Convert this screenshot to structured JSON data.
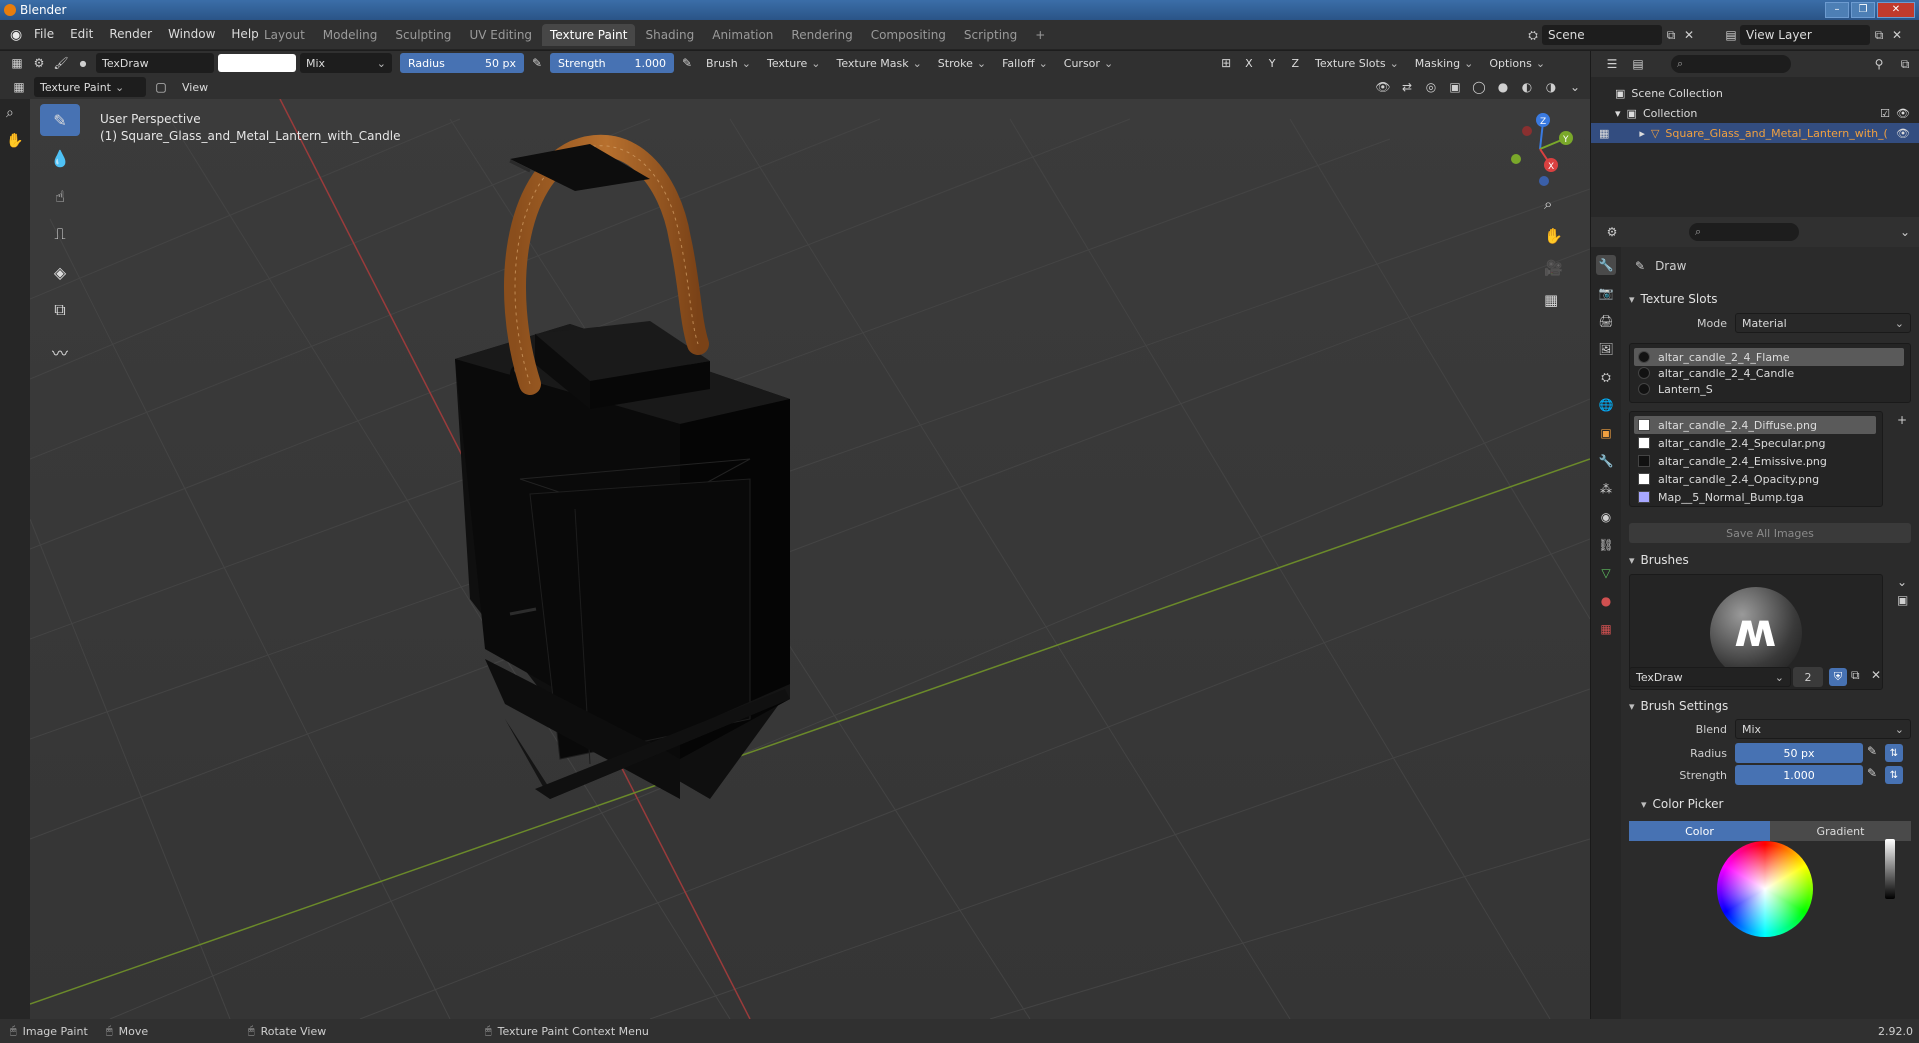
{
  "window": {
    "title": "Blender",
    "controls": [
      "–",
      "❐",
      "✕"
    ]
  },
  "menubar": {
    "menus": [
      "File",
      "Edit",
      "Render",
      "Window",
      "Help"
    ],
    "workspaces": [
      "Layout",
      "Modeling",
      "Sculpting",
      "UV Editing",
      "Texture Paint",
      "Shading",
      "Animation",
      "Rendering",
      "Compositing",
      "Scripting"
    ],
    "active_workspace": "Texture Paint",
    "add_tab": "+",
    "scene": "Scene",
    "view_layer": "View Layer"
  },
  "toolheader": {
    "brush_name": "TexDraw",
    "blend": "Mix",
    "radius_label": "Radius",
    "radius_value": "50 px",
    "strength_label": "Strength",
    "strength_value": "1.000",
    "menus": [
      "Brush",
      "Texture",
      "Texture Mask",
      "Stroke",
      "Falloff",
      "Cursor"
    ],
    "axis": [
      "X",
      "Y",
      "Z"
    ],
    "right_menus": [
      "Texture Slots",
      "Masking",
      "Options"
    ]
  },
  "modeheader": {
    "mode": "Texture Paint",
    "view": "View"
  },
  "viewport": {
    "perspective": "User Perspective",
    "object_label": "(1) Square_Glass_and_Metal_Lantern_with_Candle",
    "gizmo": {
      "z": "Z",
      "y": "Y",
      "x": "X"
    }
  },
  "outliner": {
    "scene_collection": "Scene Collection",
    "collection": "Collection",
    "object": "Square_Glass_and_Metal_Lantern_with_("
  },
  "properties": {
    "tool_name": "Draw",
    "texture_slots": {
      "title": "Texture Slots",
      "mode_label": "Mode",
      "mode_value": "Material",
      "materials": [
        "altar_candle_2_4_Flame",
        "altar_candle_2_4_Candle",
        "Lantern_S"
      ],
      "images": [
        "altar_candle_2.4_Diffuse.png",
        "altar_candle_2.4_Specular.png",
        "altar_candle_2.4_Emissive.png",
        "altar_candle_2.4_Opacity.png",
        "Map__5_Normal_Bump.tga"
      ],
      "save_all": "Save All Images"
    },
    "brushes": {
      "title": "Brushes",
      "brush_name": "TexDraw",
      "users": "2"
    },
    "brush_settings": {
      "title": "Brush Settings",
      "blend_label": "Blend",
      "blend_value": "Mix",
      "radius_label": "Radius",
      "radius_value": "50 px",
      "strength_label": "Strength",
      "strength_value": "1.000"
    },
    "color_picker": {
      "title": "Color Picker",
      "tab_color": "Color",
      "tab_gradient": "Gradient"
    }
  },
  "statusbar": {
    "items": [
      "Image Paint",
      "Move",
      "Rotate View",
      "Texture Paint Context Menu"
    ],
    "version": "2.92.0"
  }
}
